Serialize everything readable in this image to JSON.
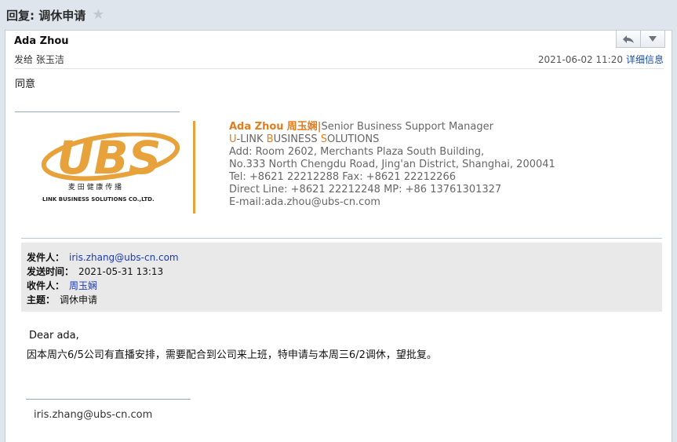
{
  "window": {
    "title": "回复: 调休申请",
    "star_icon": "star-icon"
  },
  "header": {
    "sender_name": "Ada Zhou",
    "to_line": "发给 张玉洁",
    "date": "2021-06-02 11:20",
    "details_link": "详细信息",
    "reply_icon": "reply-arrow-icon",
    "menu_icon": "chevron-down-icon"
  },
  "message": {
    "reply_text": "同意"
  },
  "signature": {
    "logo_text": "UBS",
    "logo_cn": "麦 田 健 康 传 播",
    "logo_en": "U-LINK BUSINESS SOLUTIONS CO.,LTD.",
    "name_en": "Ada Zhou",
    "name_cn": "周玉娴",
    "title": "Senior Business Support Manager",
    "company_u": "U",
    "company_1": "-LINK ",
    "company_b": "B",
    "company_2": "USINESS ",
    "company_s": "S",
    "company_3": "OLUTIONS",
    "address_1": "Add: Room 2602, Merchants Plaza South Building,",
    "address_2": "No.333 North Chengdu Road, Jing'an District, Shanghai, 200041",
    "tel_fax": "Tel: +8621 22212288  Fax: +8621 22212266",
    "direct_mp": "Direct Line: +8621 22212248   MP: +86 13761301327",
    "email": "E-mail:ada.zhou@ubs-cn.com",
    "accent_color": "#e8a23b"
  },
  "quoted": {
    "from_label": "发件人：",
    "from_value": "iris.zhang@ubs-cn.com",
    "sent_label": "发送时间：",
    "sent_value": "2021-05-31 13:13",
    "to_label": "收件人：",
    "to_value": "周玉娴",
    "subject_label": "主题：",
    "subject_value": "调休申请",
    "greeting": "Dear ada,",
    "body": "因本周六6/5公司有直播安排，需要配合到公司来上班，特申请与本周三6/2调休，望批复。",
    "footer_email": "iris.zhang@ubs-cn.com"
  }
}
